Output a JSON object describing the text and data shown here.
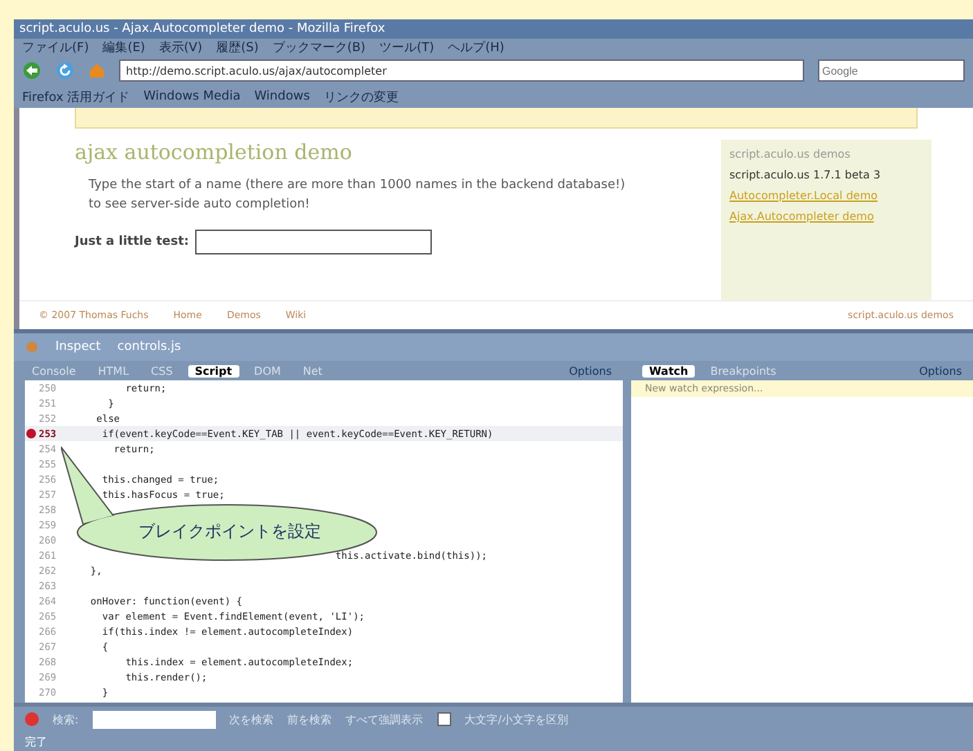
{
  "window": {
    "title": "script.aculo.us - Ajax.Autocompleter demo - Mozilla Firefox"
  },
  "menu": [
    "ファイル(F)",
    "編集(E)",
    "表示(V)",
    "履歴(S)",
    "ブックマーク(B)",
    "ツール(T)",
    "ヘルプ(H)"
  ],
  "address": {
    "value": "http://demo.script.aculo.us/ajax/autocompleter"
  },
  "search": {
    "placeholder": "Google"
  },
  "bookmarks": [
    "Firefox 活用ガイド",
    "Windows Media",
    "Windows",
    "リンクの変更"
  ],
  "page": {
    "title": "ajax autocompletion demo",
    "intro": "Type the start of a name (there are more than 1000 names in the backend database!) to see server-side auto completion!",
    "field_label": "Just a little test:",
    "side_title": "script.aculo.us demos",
    "side_text": "script.aculo.us 1.7.1 beta 3",
    "side_links": [
      "Autocompleter.Local demo",
      "Ajax.Autocompleter demo"
    ],
    "footer_links": [
      "© 2007 Thomas Fuchs",
      "Home",
      "Demos",
      "Wiki"
    ],
    "footer_right": "script.aculo.us demos"
  },
  "firebug": {
    "toolbar": [
      "Inspect",
      "controls.js"
    ],
    "tabs": [
      {
        "label": "Console",
        "selected": false
      },
      {
        "label": "HTML",
        "selected": false
      },
      {
        "label": "CSS",
        "selected": false
      },
      {
        "label": "Script",
        "selected": true
      },
      {
        "label": "DOM",
        "selected": false
      },
      {
        "label": "Net",
        "selected": false
      }
    ],
    "options": "Options",
    "lines": [
      {
        "num": "250",
        "code": "        return;",
        "breakpoint": false
      },
      {
        "num": "251",
        "code": "     }",
        "breakpoint": false
      },
      {
        "num": "252",
        "code": "   else",
        "breakpoint": false
      },
      {
        "num": "253",
        "code": "    if(event.keyCode==Event.KEY_TAB || event.keyCode==Event.KEY_RETURN)",
        "breakpoint": true
      },
      {
        "num": "254",
        "code": "      return;",
        "breakpoint": false
      },
      {
        "num": "255",
        "breakpoint": false
      },
      {
        "num": "256",
        "code": "    this.changed = true;",
        "breakpoint": false
      },
      {
        "num": "257",
        "code": "    this.hasFocus = true;",
        "breakpoint": false
      },
      {
        "num": "258",
        "breakpoint": false
      },
      {
        "num": "259",
        "breakpoint": false
      },
      {
        "num": "260",
        "breakpoint": false
      },
      {
        "num": "261",
        "code": "                                            this.activate.bind(this));",
        "breakpoint": false
      },
      {
        "num": "262",
        "code": "  },",
        "breakpoint": false
      },
      {
        "num": "263",
        "breakpoint": false
      },
      {
        "num": "264",
        "code": "  onHover: function(event) {",
        "breakpoint": false
      },
      {
        "num": "265",
        "code": "    var element = Event.findElement(event, 'LI');",
        "breakpoint": false
      },
      {
        "num": "266",
        "code": "    if(this.index != element.autocompleteIndex)",
        "breakpoint": false
      },
      {
        "num": "267",
        "code": "    {",
        "breakpoint": false
      },
      {
        "num": "268",
        "code": "        this.index = element.autocompleteIndex;",
        "breakpoint": false
      },
      {
        "num": "269",
        "code": "        this.render();",
        "breakpoint": false
      },
      {
        "num": "270",
        "code": "    }",
        "breakpoint": false
      }
    ],
    "callout": "ブレイクポイントを設定",
    "side_tabs": [
      {
        "label": "Watch",
        "selected": true
      },
      {
        "label": "Breakpoints",
        "selected": false
      }
    ],
    "side_options": "Options",
    "watch_row": "New watch expression...",
    "find": {
      "label": "検索:",
      "next": "次を検索",
      "prev": "前を検索",
      "highlight": "すべて強調表示",
      "match_case": {
        "label": "大文字/小文字を区別",
        "checked": false
      }
    }
  },
  "status": "完了"
}
